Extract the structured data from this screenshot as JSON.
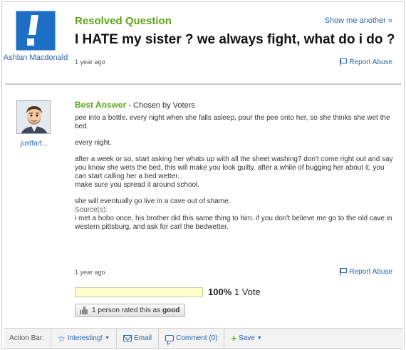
{
  "question": {
    "status": "Resolved Question",
    "show_more": "Show me another »",
    "title": "I HATE my sister ? we always fight, what do i do ?",
    "age": "1 year ago",
    "report": "Report Abuse",
    "asker": "Ashlan Macdonald"
  },
  "answer": {
    "label": "Best Answer",
    "chosen": " - Chosen by Voters",
    "user": "justfart...",
    "paragraphs": {
      "p1": "pee into a bottle. every night when she falls asleep, pour the pee onto her, so she thinks she wet the bed.",
      "p2": "every night.",
      "p3": "after a week or so, start asking her whats up with all the sheet washing? don't come right out and say you know she wets the bed, this will make you look guilty. after a while of bugging her about it, you can start calling her a bed wetter.",
      "p4": "make sure you spread it around school.",
      "p5": "she will eventually go live in a cave out of shame.",
      "source_label": "Source(s):",
      "source": "i met a hobo once, his brother did this same thing to him. if you don't believe me go to the old cave in western pittsburg, and ask for carl the bedwetter."
    },
    "age": "1 year ago",
    "report": "Report Abuse"
  },
  "rating": {
    "percent": "100%",
    "percent_value": 100,
    "votes": "1 Vote",
    "rated_text": "1 person rated this as",
    "rated_value": "good"
  },
  "action_bar": {
    "label": "Action Bar:",
    "interesting": "Interesting!",
    "email": "Email",
    "comment": "Comment (0)",
    "save": "Save"
  },
  "colors": {
    "brand_green": "#5aa616",
    "link_blue": "#2a64b0",
    "avatar_blue": "#1d6fc6"
  }
}
